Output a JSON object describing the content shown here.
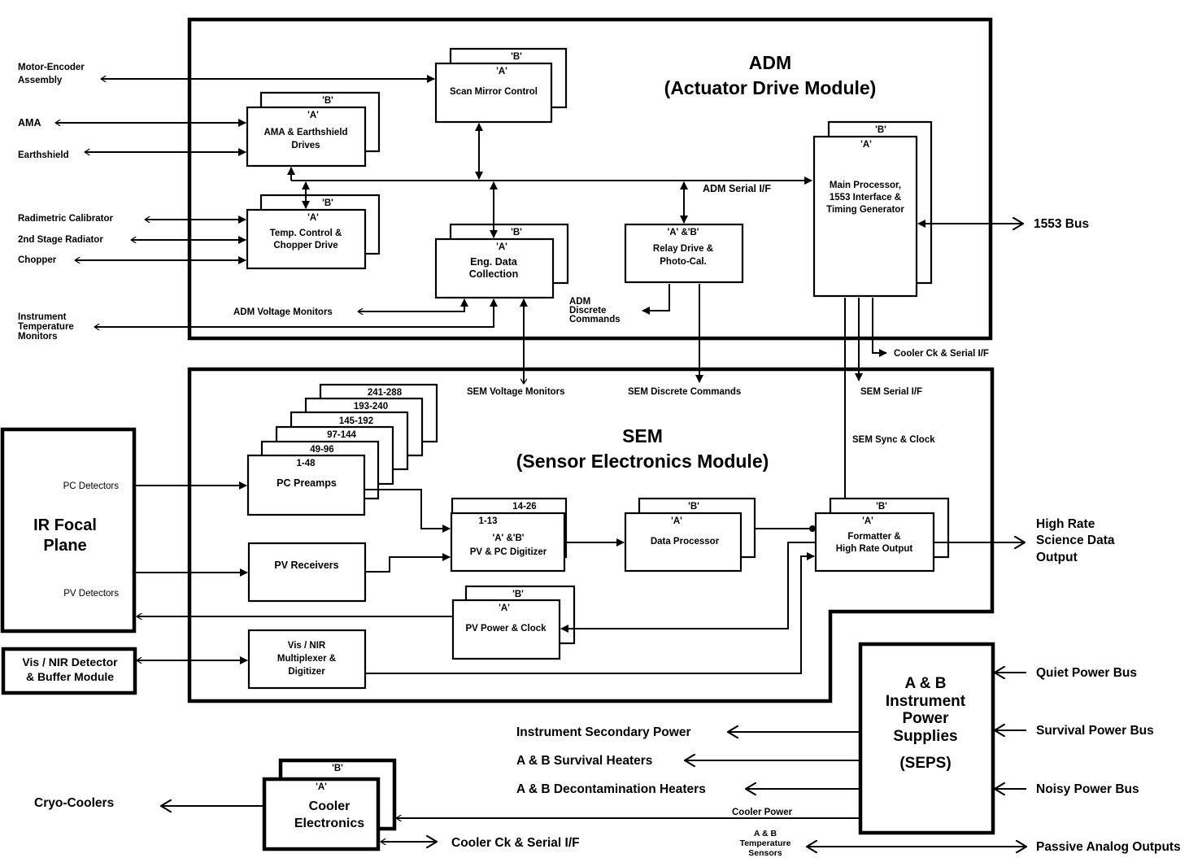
{
  "modules": {
    "adm": {
      "title": "ADM",
      "subtitle": "(Actuator Drive Module)"
    },
    "sem": {
      "title": "SEM",
      "subtitle": "(Sensor Electronics Module)"
    }
  },
  "blocks": {
    "scan_mirror": {
      "b": "'B'",
      "a": "'A'",
      "lines": [
        "Scan Mirror Control"
      ]
    },
    "ama_drives": {
      "b": "'B'",
      "a": "'A'",
      "lines": [
        "AMA & Earthshield",
        "Drives"
      ]
    },
    "temp_control": {
      "b": "'B'",
      "a": "'A'",
      "lines": [
        "Temp. Control &",
        "Chopper Drive"
      ]
    },
    "eng_data": {
      "b": "'B'",
      "a": "'A'",
      "lines": [
        "Eng. Data",
        "Collection"
      ]
    },
    "relay_drive": {
      "a": "'A' &'B'",
      "lines": [
        "Relay Drive &",
        "Photo-Cal."
      ]
    },
    "main_processor": {
      "b": "'B'",
      "a": "'A'",
      "lines": [
        "Main Processor,",
        "1553 Interface &",
        "Timing Generator"
      ]
    },
    "pc_preamps": {
      "stack": [
        "241-288",
        "193-240",
        "145-192",
        "97-144",
        "49-96",
        "1-48"
      ],
      "lines": [
        "PC Preamps"
      ]
    },
    "pv_receivers": {
      "lines": [
        "PV Receivers"
      ]
    },
    "vis_nir_mux": {
      "lines": [
        "Vis / NIR",
        "Multiplexer &",
        "Digitizer"
      ]
    },
    "digitizer": {
      "b": "14-26",
      "a": "1-13",
      "lines": [
        "'A' &'B'",
        "PV & PC Digitizer"
      ]
    },
    "data_processor": {
      "b": "'B'",
      "a": "'A'",
      "lines": [
        "Data Processor"
      ]
    },
    "formatter": {
      "b": "'B'",
      "a": "'A'",
      "lines": [
        "Formatter &",
        "High Rate Output"
      ]
    },
    "pv_power": {
      "b": "'B'",
      "a": "'A'",
      "lines": [
        "PV Power & Clock"
      ]
    },
    "ir_focal_plane": {
      "lines": [
        "IR Focal",
        "Plane"
      ],
      "pc_label": "PC Detectors",
      "pv_label": "PV Detectors"
    },
    "vis_nir_detector": {
      "lines": [
        "Vis / NIR Detector",
        "& Buffer Module"
      ]
    },
    "power_supplies": {
      "lines": [
        "A & B",
        "Instrument",
        "Power",
        "Supplies"
      ],
      "sub": "(SEPS)"
    },
    "cooler_electronics": {
      "b": "'B'",
      "a": "'A'",
      "lines": [
        "Cooler",
        "Electronics"
      ]
    }
  },
  "external_labels": {
    "motor_encoder": [
      "Motor-Encoder",
      "Assembly"
    ],
    "ama": "AMA",
    "earthshield": "Earthshield",
    "radimetric_calibrator": "Radimetric Calibrator",
    "second_stage_radiator": "2nd Stage Radiator",
    "chopper": "Chopper",
    "instrument_temp_monitors": [
      "Instrument",
      "Temperature",
      "Monitors"
    ],
    "bus_1553": "1553 Bus",
    "cooler_ck_serial_top": "Cooler Ck & Serial I/F",
    "high_rate_output": [
      "High Rate",
      "Science Data",
      "Output"
    ],
    "quiet_power_bus": "Quiet Power Bus",
    "survival_power_bus": "Survival Power Bus",
    "noisy_power_bus": "Noisy Power Bus",
    "passive_analog_outputs": "Passive Analog Outputs",
    "instrument_secondary_power": "Instrument Secondary Power",
    "survival_heaters": "A & B Survival Heaters",
    "decontamination_heaters": "A & B Decontamination Heaters",
    "cooler_power": "Cooler Power",
    "temperature_sensors": [
      "A & B",
      "Temperature",
      "Sensors"
    ],
    "cooler_ck_serial_bottom": "Cooler Ck & Serial I/F",
    "cryo_coolers": "Cryo-Coolers"
  },
  "signal_labels": {
    "adm_serial": "ADM Serial I/F",
    "adm_voltage_monitors": "ADM Voltage Monitors",
    "adm_discrete_commands": [
      "ADM",
      "Discrete",
      "Commands"
    ],
    "sem_voltage_monitors": "SEM Voltage Monitors",
    "sem_discrete_commands": "SEM Discrete Commands",
    "sem_serial": "SEM Serial I/F",
    "sem_sync_clock": "SEM Sync & Clock"
  }
}
